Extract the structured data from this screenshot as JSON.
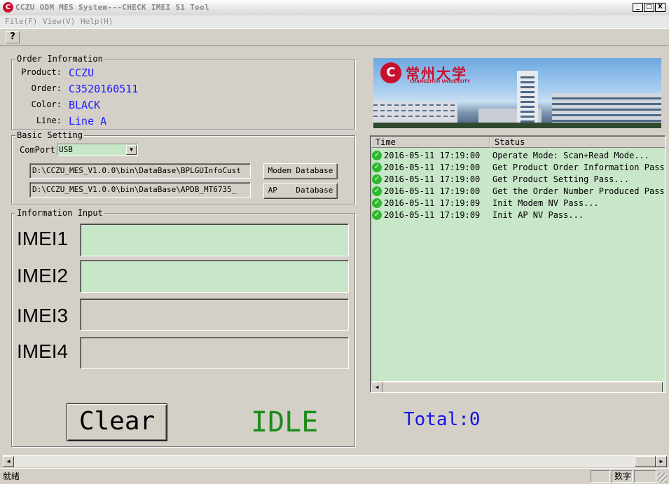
{
  "window": {
    "title": "CCZU ODM MES System---CHECK IMEI S1 Tool",
    "app_icon": "C",
    "minimize": "_",
    "maximize": "□",
    "close": "X"
  },
  "menu": [
    "File(F)",
    "View(V)",
    "Help(H)"
  ],
  "toolbar": {
    "help_icon": "?"
  },
  "order_info": {
    "title": "Order Information",
    "fields": [
      {
        "label": "Product:",
        "value": "CCZU"
      },
      {
        "label": "Order:",
        "value": "C3520160511"
      },
      {
        "label": "Color:",
        "value": "BLACK"
      },
      {
        "label": "Line:",
        "value": "Line A"
      }
    ]
  },
  "basic_setting": {
    "title": "Basic Setting",
    "comport_label": "ComPort",
    "comport_value": "USB",
    "modem_path": "D:\\CCZU_MES_V1.0.0\\bin\\DataBase\\BPLGUInfoCust",
    "modem_button": "Modem Database",
    "ap_path": "D:\\CCZU_MES_V1.0.0\\bin\\DataBase\\APDB_MT6735_",
    "ap_button": "AP    Database"
  },
  "info_input": {
    "title": "Information Input",
    "imei_labels": [
      "IMEI1",
      "IMEI2",
      "IMEI3",
      "IMEI4"
    ],
    "imei_values": [
      "",
      "",
      "",
      ""
    ]
  },
  "banner": {
    "logo_text": "常州大学",
    "logo_subtext": "CHANGZHOU UNIVERSITY"
  },
  "log": {
    "columns": [
      "Time",
      "Status"
    ],
    "rows": [
      {
        "time": "2016-05-11   17:19:00",
        "status": "Operate Mode: Scan+Read Mode..."
      },
      {
        "time": "2016-05-11   17:19:00",
        "status": "Get Product Order Information Pass..."
      },
      {
        "time": "2016-05-11   17:19:00",
        "status": "Get Product Setting Pass..."
      },
      {
        "time": "2016-05-11   17:19:00",
        "status": "Get the Order Number Produced Pass"
      },
      {
        "time": "2016-05-11   17:19:09",
        "status": "Init Modem NV Pass..."
      },
      {
        "time": "2016-05-11   17:19:09",
        "status": "Init AP NV Pass..."
      }
    ]
  },
  "clear_button": "Clear",
  "status": "IDLE",
  "total": "Total:0",
  "statusbar": {
    "ready": "就绪",
    "num": "数字"
  },
  "colors": {
    "accent_blue": "#1414e6",
    "status_green": "#1a8c1a",
    "input_green": "#c8e6c8"
  }
}
